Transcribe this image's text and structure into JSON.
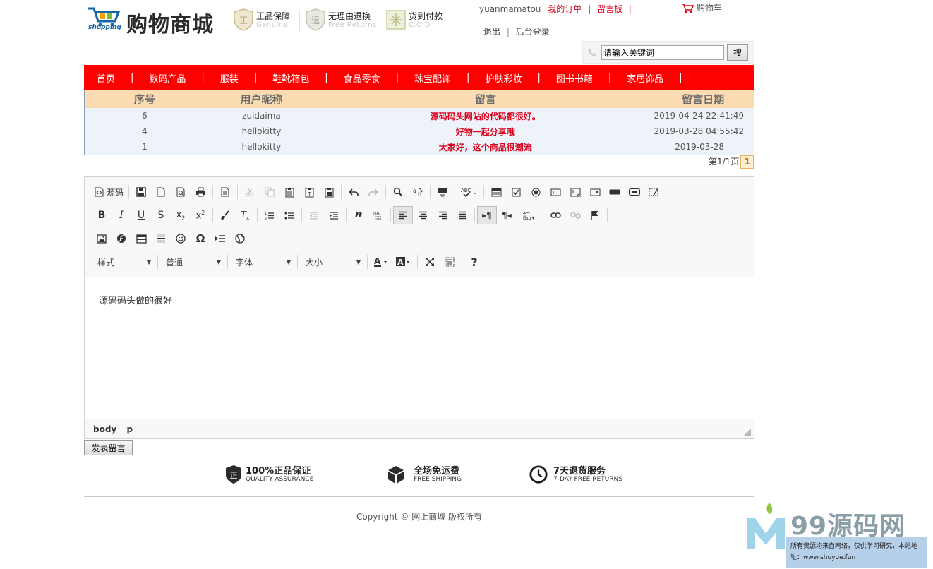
{
  "header": {
    "logo_word": "shopping",
    "site_title": "购物商城",
    "promises": [
      {
        "title": "正品保障",
        "subtitle": "Genuine",
        "badge": "正"
      },
      {
        "title": "无理由退换",
        "subtitle": "Free Returns",
        "badge": "退"
      },
      {
        "title": "货到付款",
        "subtitle": "C.O.D",
        "badge": ""
      }
    ],
    "username": "yuanmamatou",
    "my_orders": "我的订单",
    "message_board": "留言板",
    "pipe": "|",
    "cart": "购物车",
    "logout": "退出",
    "admin_login": "后台登录",
    "search_value": "请输入关键词",
    "search_button": "搜"
  },
  "nav": {
    "items": [
      "首页",
      "数码产品",
      "服装",
      "鞋靴箱包",
      "食品零食",
      "珠宝配饰",
      "护肤彩妆",
      "图书书籍",
      "家居饰品"
    ],
    "separator": "|"
  },
  "messages": {
    "columns": [
      "序号",
      "用户昵称",
      "留言",
      "留言日期"
    ],
    "rows": [
      {
        "id": "6",
        "user": "zuidaima",
        "text": "源码码头网站的代码都很好。",
        "date": "2019-04-24 22:41:49"
      },
      {
        "id": "4",
        "user": "hellokitty",
        "text": "好物一起分享哦",
        "date": "2019-03-28 04:55:42"
      },
      {
        "id": "1",
        "user": "hellokitty",
        "text": "大家好，这个商品很潮流",
        "date": "2019-03-28"
      }
    ]
  },
  "pager": {
    "label": "第1/1页",
    "current": "1"
  },
  "editor": {
    "source_label": "源码",
    "style_select": "样式",
    "format_select": "普通",
    "font_select": "字体",
    "size_select": "大小",
    "content": "源码码头做的很好",
    "path": [
      "body",
      "p"
    ]
  },
  "submit_button": "发表留言",
  "services": [
    {
      "title": "100%正品保证",
      "subtitle": "QUALITY ASSURANCE"
    },
    {
      "title": "全场免运费",
      "subtitle": "FREE SHIPPING"
    },
    {
      "title": "7天退货服务",
      "subtitle": "7-DAY FREE RETURNS"
    }
  ],
  "copyright": "Copyright © 网上商城 版权所有",
  "watermark": {
    "title": "99源码网",
    "note": "所有资源均来自网络，仅供学习研究，本站地址：www.shuyue.fun"
  },
  "colors": {
    "nav_bg": "#fd0000",
    "table_head_bg": "#fbdcb2",
    "accent_red": "#d9001b"
  }
}
